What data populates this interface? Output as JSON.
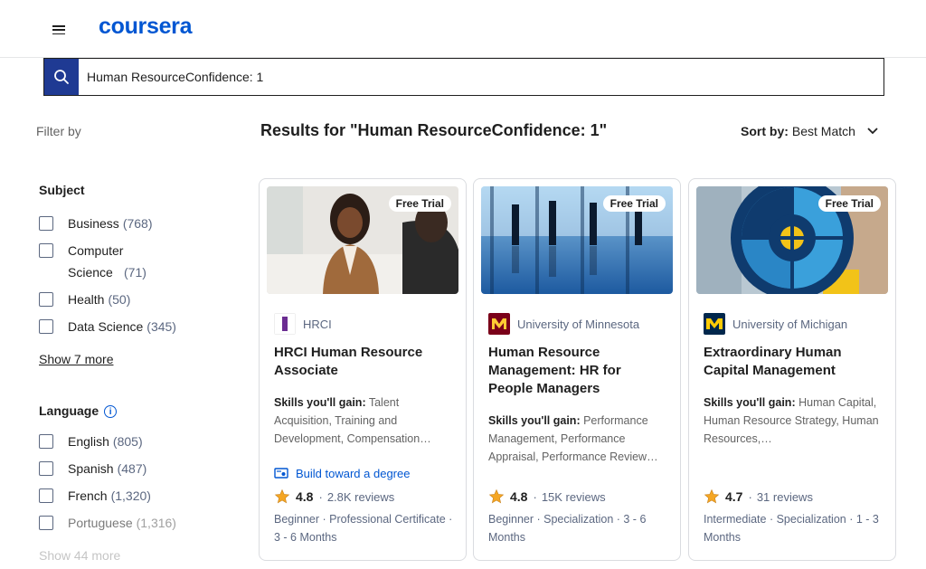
{
  "header": {
    "logo": "coursera"
  },
  "search": {
    "value": "Human ResourceConfidence: 1"
  },
  "filters": {
    "filter_by": "Filter by",
    "subject": {
      "title": "Subject",
      "items": [
        {
          "label": "Business",
          "count": "(768)"
        },
        {
          "label": "Computer Science",
          "count": "(71)"
        },
        {
          "label": "Health",
          "count": "(50)"
        },
        {
          "label": "Data Science",
          "count": "(345)"
        }
      ],
      "show_more": "Show 7 more"
    },
    "language": {
      "title": "Language",
      "items": [
        {
          "label": "English",
          "count": "(805)"
        },
        {
          "label": "Spanish",
          "count": "(487)"
        },
        {
          "label": "French",
          "count": "(1,320)"
        },
        {
          "label": "Portuguese",
          "count": "(1,316)"
        }
      ],
      "show_more": "Show 44 more"
    }
  },
  "results": {
    "title": "Results for \"Human ResourceConfidence: 1\"",
    "sort_label": "Sort by:",
    "sort_value": "Best Match"
  },
  "cards": [
    {
      "badge": "Free Trial",
      "partner": "HRCI",
      "title": "HRCI Human Resource Associate",
      "skills_label": "Skills you'll gain:",
      "skills": "Talent Acquisition, Training and Development, Compensation…",
      "degree": "Build toward a degree",
      "rating": "4.8",
      "reviews": "2.8K reviews",
      "meta": "Beginner · Professional Certificate · 3 - 6 Months"
    },
    {
      "badge": "Free Trial",
      "partner": "University of Minnesota",
      "title": "Human Resource Management: HR for People Managers",
      "skills_label": "Skills you'll gain:",
      "skills": "Performance Management, Performance Appraisal, Performance Review…",
      "rating": "4.8",
      "reviews": "15K reviews",
      "meta": "Beginner · Specialization · 3 - 6 Months"
    },
    {
      "badge": "Free Trial",
      "partner": "University of Michigan",
      "title": "Extraordinary Human Capital Management",
      "skills_label": "Skills you'll gain:",
      "skills": "Human Capital, Human Resource Strategy, Human Resources,…",
      "rating": "4.7",
      "reviews": "31 reviews",
      "meta": "Intermediate · Specialization · 1 - 3 Months"
    }
  ],
  "colors": {
    "brand": "#0056d2",
    "search_button": "#1f3a93",
    "star": "#f5a623"
  }
}
